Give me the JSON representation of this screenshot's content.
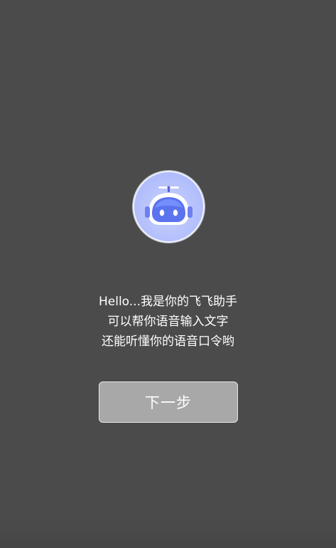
{
  "intro": {
    "line1": "Hello...我是你的飞飞助手",
    "line2": "可以帮你语音输入文字",
    "line3": "还能听懂你的语音口令哟"
  },
  "next_button": {
    "label": "下一步"
  },
  "assistant_avatar": {
    "icon": "robot-head-icon",
    "accent_color": "#6b7cf6",
    "background_color": "#b8c3fd"
  },
  "colors": {
    "background": "#4b4b4b",
    "button_fill": "#a8a8a8",
    "button_border": "#e6e6e6",
    "text": "#ffffff"
  }
}
